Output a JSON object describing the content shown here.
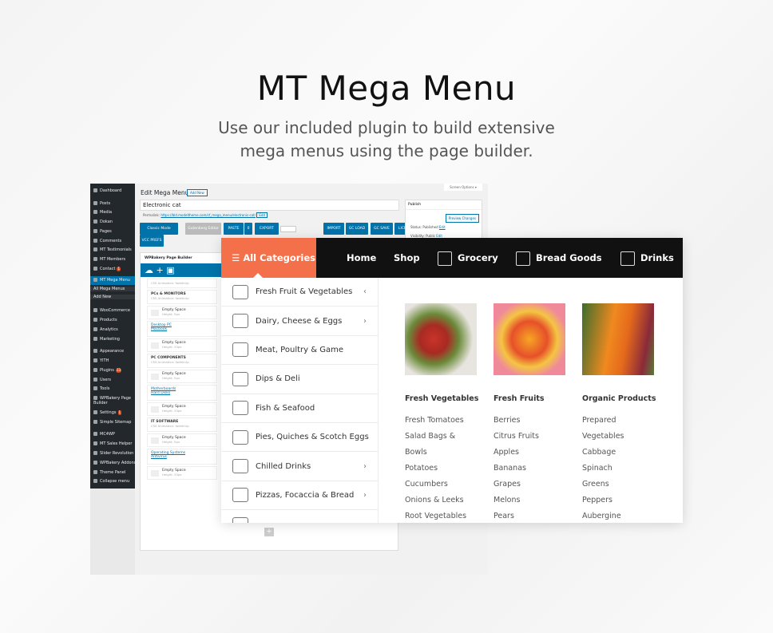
{
  "hero": {
    "title": "MT Mega Menu",
    "subtitle_line1": "Use our included plugin to build extensive",
    "subtitle_line2": "mega menus using the page builder."
  },
  "wp": {
    "sidebar": [
      {
        "label": "Dashboard"
      },
      {
        "label": "Posts"
      },
      {
        "label": "Media"
      },
      {
        "label": "Dokan"
      },
      {
        "label": "Pages"
      },
      {
        "label": "Comments"
      },
      {
        "label": "MT Testimonials"
      },
      {
        "label": "MT Members"
      },
      {
        "label": "Contact",
        "badge": "1"
      },
      {
        "label": "MT Mega Menu",
        "active": true
      },
      {
        "label": "All Mega Menus",
        "sub": true
      },
      {
        "label": "Add New",
        "sub": true
      },
      {
        "label": "WooCommerce"
      },
      {
        "label": "Products"
      },
      {
        "label": "Analytics"
      },
      {
        "label": "Marketing"
      },
      {
        "label": "Appearance"
      },
      {
        "label": "YITH"
      },
      {
        "label": "Plugins",
        "badge": "13"
      },
      {
        "label": "Users"
      },
      {
        "label": "Tools"
      },
      {
        "label": "WPBakery Page Builder"
      },
      {
        "label": "Settings",
        "badge": "1"
      },
      {
        "label": "Simple Sitemap"
      },
      {
        "label": "MC4WP"
      },
      {
        "label": "MT Sales Helper"
      },
      {
        "label": "Slider Revolution"
      },
      {
        "label": "WPBakery Addons"
      },
      {
        "label": "Theme Panel"
      },
      {
        "label": "Collapse menu"
      }
    ],
    "page_title": "Edit Mega Menu",
    "add_new": "Add New",
    "screen_options": "Screen Options ▾",
    "post_title": "Electronic cat",
    "permalink_label": "Permalink:",
    "permalink": "https://bld.modeltheme.com/cf_mega_menu/electronic-cat/",
    "edit": "Edit",
    "toolbar": [
      "Classic Mode",
      "Gutenberg Editor",
      "PASTE",
      "0",
      "EXPORT",
      "IMPORT",
      "GC LOAD",
      "GC SAVE",
      "LICENSE",
      "VCC PREFS"
    ],
    "builder_title": "WPBakery Page Builder",
    "elements": [
      {
        "kind": "note",
        "text": "CSS Animation: fadeInUp"
      },
      {
        "kind": "heading",
        "text": "PCs & MONITORS",
        "note": "CSS Animation: fadeInUp"
      },
      {
        "kind": "space",
        "text": "Empty Space",
        "note": "Height: 5px"
      },
      {
        "kind": "links",
        "text": "Desktop PC",
        "text2": "Macbook"
      },
      {
        "kind": "space",
        "text": "Empty Space",
        "note": "Height: 25px"
      },
      {
        "kind": "heading",
        "text": "PC COMPONENTS",
        "note": "CSS Animation: fadeInUp"
      },
      {
        "kind": "space",
        "text": "Empty Space",
        "note": "Height: 5px"
      },
      {
        "kind": "links",
        "text": "Motherboards",
        "text2": "Hard Disks"
      },
      {
        "kind": "space",
        "text": "Empty Space",
        "note": "Height: 25px"
      },
      {
        "kind": "heading",
        "text": "IT SOFTWARE",
        "note": "CSS Animation: fadeInUp"
      },
      {
        "kind": "space",
        "text": "Empty Space",
        "note": "Height: 5px"
      },
      {
        "kind": "links",
        "text": "Operating Systems",
        "text2": "Antivirus"
      },
      {
        "kind": "space",
        "text": "Empty Space",
        "note": "Height: 25px"
      }
    ],
    "publish": {
      "title": "Publish",
      "preview": "Preview Changes",
      "status": "Status: Published",
      "visibility": "Visibility: Public",
      "edit": "Edit"
    }
  },
  "menu": {
    "all_categories": "All Categories",
    "accent": "#f4704a",
    "nav": [
      {
        "label": "Home"
      },
      {
        "label": "Shop"
      },
      {
        "label": "Grocery",
        "icon": "grocery-icon"
      },
      {
        "label": "Bread Goods",
        "icon": "bread-icon"
      },
      {
        "label": "Drinks",
        "icon": "drinks-icon"
      }
    ],
    "categories": [
      {
        "label": "Fresh Fruit & Vegetables",
        "chev": "‹"
      },
      {
        "label": "Dairy, Cheese & Eggs",
        "chev": "›"
      },
      {
        "label": "Meat, Poultry & Game"
      },
      {
        "label": "Dips & Deli"
      },
      {
        "label": "Fish & Seafood"
      },
      {
        "label": "Pies, Quiches & Scotch Eggs"
      },
      {
        "label": "Chilled Drinks",
        "chev": "›"
      },
      {
        "label": "Pizzas, Focaccia & Bread",
        "chev": "›"
      },
      {
        "label": ""
      }
    ],
    "columns": [
      {
        "heading": "Fresh Vegetables",
        "items": [
          "Fresh Tomatoes",
          "Salad Bags &",
          "Bowls",
          "Potatoes",
          "Cucumbers",
          "Onions & Leeks",
          "Root Vegetables"
        ]
      },
      {
        "heading": "Fresh Fruits",
        "items": [
          "Berries",
          "Citrus Fruits",
          "Apples",
          "Bananas",
          "Grapes",
          "Melons",
          "Pears"
        ]
      },
      {
        "heading": "Organic Products",
        "items": [
          "Prepared",
          "Vegetables",
          "Cabbage",
          "Spinach",
          "Greens",
          "Peppers",
          "Aubergine"
        ]
      }
    ]
  }
}
